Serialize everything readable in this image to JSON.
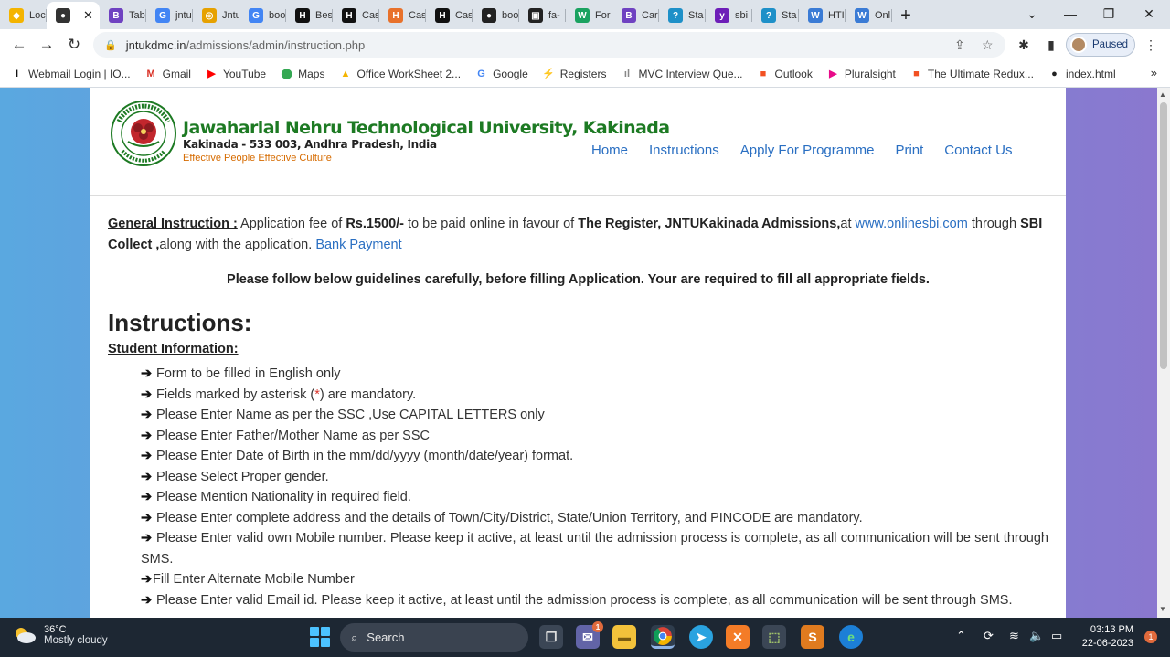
{
  "browser": {
    "tabs": [
      {
        "title": "Loc",
        "color": "#f4b400",
        "glyph": "◆"
      },
      {
        "title": "",
        "color": "#333333",
        "glyph": "●",
        "active": true
      },
      {
        "title": "Tab",
        "color": "#6f42c1",
        "glyph": "B"
      },
      {
        "title": "jntu",
        "color": "#4285f4",
        "glyph": "G"
      },
      {
        "title": "Jntu",
        "color": "#e6a100",
        "glyph": "◎"
      },
      {
        "title": "boo",
        "color": "#4285f4",
        "glyph": "G"
      },
      {
        "title": "Bes",
        "color": "#111111",
        "glyph": "H"
      },
      {
        "title": "Cas",
        "color": "#111111",
        "glyph": "H"
      },
      {
        "title": "Cas",
        "color": "#e8712b",
        "glyph": "H"
      },
      {
        "title": "Cas",
        "color": "#111111",
        "glyph": "H"
      },
      {
        "title": "boo",
        "color": "#222222",
        "glyph": "●"
      },
      {
        "title": "fa-",
        "color": "#222222",
        "glyph": "▣"
      },
      {
        "title": "For",
        "color": "#1aa260",
        "glyph": "W"
      },
      {
        "title": "Car",
        "color": "#6f42c1",
        "glyph": "B"
      },
      {
        "title": "Sta",
        "color": "#1e90c8",
        "glyph": "?"
      },
      {
        "title": "sbi",
        "color": "#6d1eb8",
        "glyph": "y"
      },
      {
        "title": "Sta",
        "color": "#1e90c8",
        "glyph": "?"
      },
      {
        "title": "HTI",
        "color": "#3a7bd5",
        "glyph": "W"
      },
      {
        "title": "Onl",
        "color": "#3a7bd5",
        "glyph": "W"
      }
    ],
    "new_tab": "+",
    "url_domain": "jntukdmc.in",
    "url_path": "/admissions/admin/instruction.php",
    "profile_status": "Paused",
    "bookmarks": [
      {
        "label": "Webmail Login | IO...",
        "color": "#111111",
        "glyph": "I"
      },
      {
        "label": "Gmail",
        "color": "#d93025",
        "glyph": "M"
      },
      {
        "label": "YouTube",
        "color": "#ff0000",
        "glyph": "▶"
      },
      {
        "label": "Maps",
        "color": "#34a853",
        "glyph": "⬤"
      },
      {
        "label": "Office WorkSheet 2...",
        "color": "#f4b400",
        "glyph": "▲"
      },
      {
        "label": "Google",
        "color": "#4285f4",
        "glyph": "G"
      },
      {
        "label": "Registers",
        "color": "#7b2cbf",
        "glyph": "⚡"
      },
      {
        "label": "MVC Interview Que...",
        "color": "#888888",
        "glyph": "ıl"
      },
      {
        "label": "Outlook",
        "color": "#f25022",
        "glyph": "■"
      },
      {
        "label": "Pluralsight",
        "color": "#e80a89",
        "glyph": "▶"
      },
      {
        "label": "The Ultimate Redux...",
        "color": "#f25022",
        "glyph": "■"
      },
      {
        "label": "index.html",
        "color": "#222222",
        "glyph": "●"
      }
    ]
  },
  "site": {
    "name": "Jawaharlal Nehru Technological University, Kakinada",
    "address": "Kakinada - 533 003, Andhra Pradesh, India",
    "motto": "Effective People Effective Culture",
    "nav": [
      "Home",
      "Instructions",
      "Apply For Programme",
      "Print",
      "Contact Us"
    ]
  },
  "general": {
    "label": "General Instruction :",
    "t1": " Application fee of ",
    "fee": "Rs.1500/-",
    "t2": " to be paid online in favour of ",
    "payee": "The Register, JNTUKakinada Admissions,",
    "t3": "at ",
    "site_link": "www.onlinesbi.com",
    "t4": " through ",
    "collect": "SBI Collect ,",
    "t5": "along with the application. ",
    "bank_link": "Bank Payment"
  },
  "guideline": "Please follow below guidelines carefully, before filling Application. Your are required to fill all appropriate fields.",
  "instructions_heading": "Instructions:",
  "student_info_heading": "Student Information:",
  "items": [
    "Form to be filled in English only",
    "Please Enter Name as per the SSC ,Use CAPITAL LETTERS only",
    "Please Enter Father/Mother Name as per SSC",
    "Please Enter Date of Birth in the mm/dd/yyyy (month/date/year) format.",
    "Please Select Proper gender.",
    "Please Mention Nationality in required field.",
    "Please Enter complete address and the details of Town/City/District, State/Union Territory, and PINCODE are mandatory.",
    "Please Enter valid own Mobile number. Please keep it active, at least until the admission process is complete, as all communication will be sent through SMS.",
    "Fill Enter Alternate Mobile Number",
    "Please Enter valid Email id. Please keep it active, at least until the admission process is complete, as all communication will be sent through SMS."
  ],
  "asterisk_item": {
    "before": "Fields marked by asterisk (",
    "mark": "*",
    "after": ") are mandatory."
  },
  "taskbar": {
    "temp": "36°C",
    "condition": "Mostly cloudy",
    "search": "Search",
    "time": "03:13 PM",
    "date": "22-06-2023",
    "notifications": "1",
    "teams_badge": "1"
  }
}
